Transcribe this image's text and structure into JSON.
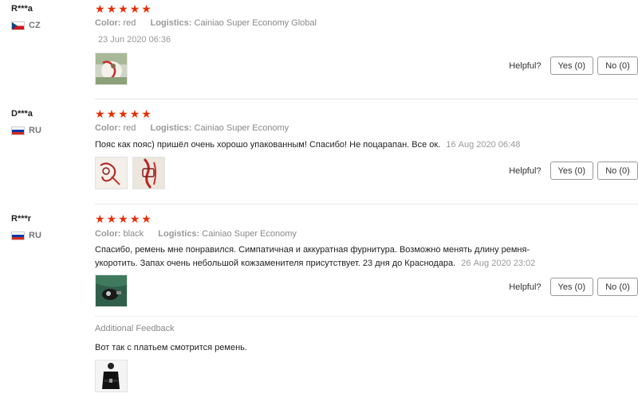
{
  "labels": {
    "color": "Color:",
    "logistics": "Logistics:",
    "helpful": "Helpful?"
  },
  "reviews": [
    {
      "buyer": "R***a",
      "country": "CZ",
      "stars": [
        "★",
        "★",
        "★",
        "★",
        "★"
      ],
      "color_value": "red",
      "logistics_value": "Cainiao Super Economy Global",
      "text": "",
      "date": "23 Jun 2020 06:36",
      "yes_label": "Yes (0)",
      "no_label": "No (0)"
    },
    {
      "buyer": "D***a",
      "country": "RU",
      "stars": [
        "★",
        "★",
        "★",
        "★",
        "★"
      ],
      "color_value": "red",
      "logistics_value": "Cainiao Super Economy",
      "text": "Пояс как пояс) пришёл очень хорошо упакованным! Спасибо! Не поцарапан. Все ок.",
      "date": "16 Aug 2020 06:48",
      "yes_label": "Yes (0)",
      "no_label": "No (0)"
    },
    {
      "buyer": "R***r",
      "country": "RU",
      "stars": [
        "★",
        "★",
        "★",
        "★",
        "★"
      ],
      "color_value": "black",
      "logistics_value": "Cainiao Super Economy",
      "text_line1": "Спасибо, ремень мне понравился. Симпатичная и аккуратная фурнитура. Возможно менять длину ремня-",
      "text_line2": "укоротить. Запах очень небольшой кожзаменителя присутствует. 23 дня до Краснодара.",
      "date": "26 Aug 2020 23:02",
      "yes_label": "Yes (0)",
      "no_label": "No (0)",
      "additional_feedback_title": "Additional Feedback",
      "additional_feedback_text": "Вот так с платьем смотрится ремень."
    }
  ],
  "colors": {
    "star": "#e62e04",
    "border": "#e8e8e8"
  }
}
